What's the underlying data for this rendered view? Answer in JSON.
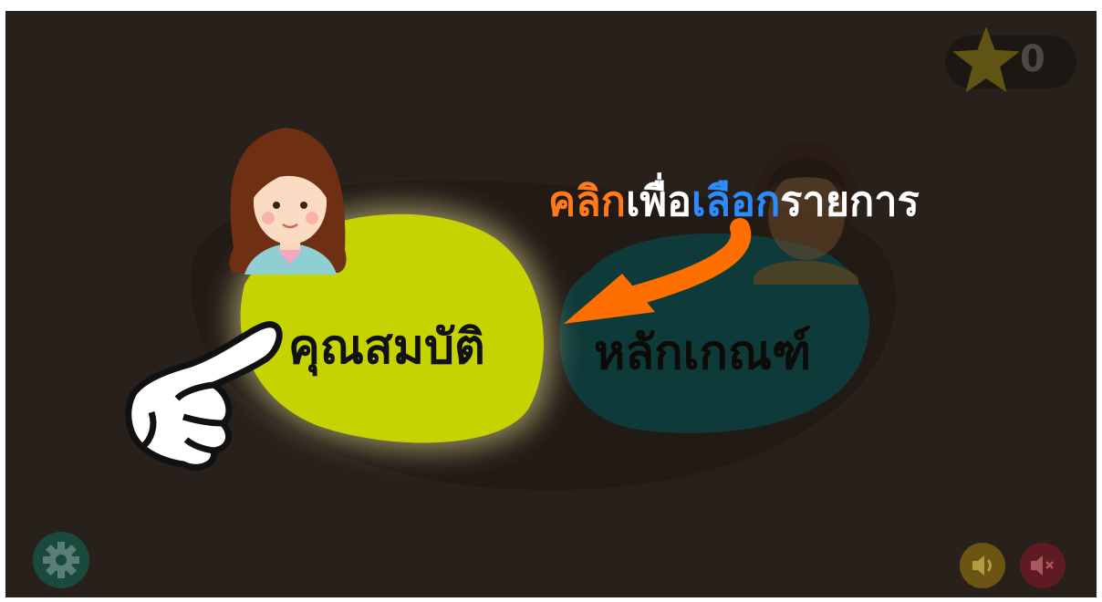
{
  "score": {
    "value": "0",
    "icon": "star-icon"
  },
  "instruction": {
    "part1": "คลิก",
    "part2": "เพื่อ",
    "part3": "เลือก",
    "part4": "รายการ"
  },
  "options": [
    {
      "label": "คุณสมบัติ",
      "character": "girl-avatar",
      "selected": true,
      "color": "#c5d400"
    },
    {
      "label": "หลักเกณฑ์",
      "character": "boy-avatar",
      "selected": false,
      "color": "#0f3a3a"
    }
  ],
  "controls": {
    "settings_icon": "gear-icon",
    "sound_on_icon": "speaker-on-icon",
    "sound_off_icon": "speaker-mute-icon"
  },
  "colors": {
    "background": "#28201b",
    "highlight_orange": "#ff7a1a",
    "highlight_blue": "#2b8cff"
  }
}
